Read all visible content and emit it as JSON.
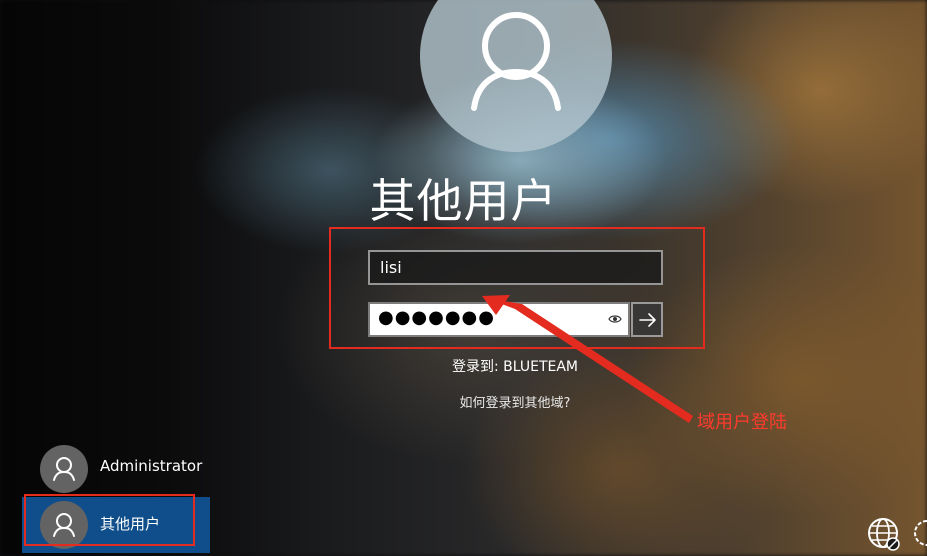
{
  "login": {
    "title": "其他用户",
    "username_value": "lisi",
    "password_masked": "●●●●●●●",
    "signin_to": "登录到: BLUETEAM",
    "other_domain_link": "如何登录到其他域?"
  },
  "annotation": {
    "text": "域用户登陆",
    "color": "#e42b1f"
  },
  "users": [
    {
      "label": "Administrator",
      "selected": false
    },
    {
      "label": "其他用户",
      "selected": true
    }
  ],
  "icons": {
    "avatar": "user-icon",
    "reveal": "eye-icon",
    "submit": "arrow-right-icon",
    "network": "globe-icon",
    "accessibility": "ease-of-access-icon"
  },
  "colors": {
    "selected_user_bg": "#0f4e8a",
    "annotation_red": "#e42b1f"
  }
}
